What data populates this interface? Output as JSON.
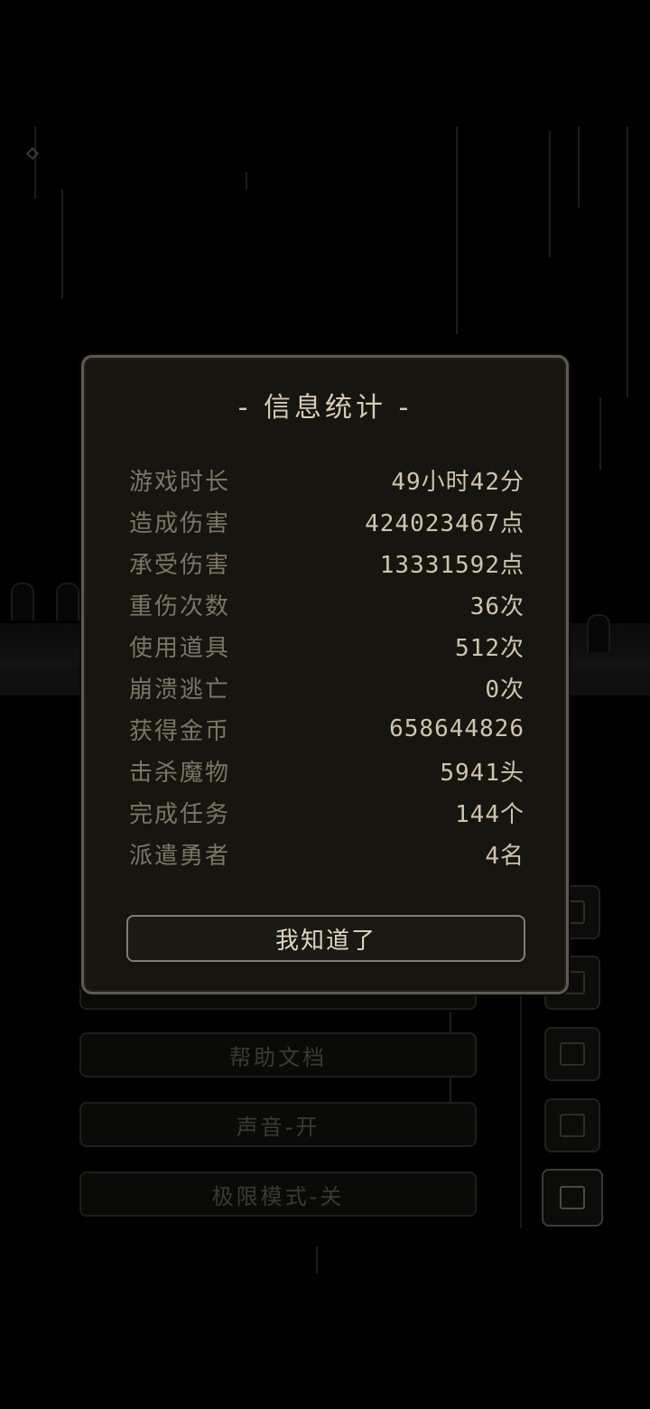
{
  "dialog": {
    "title": "- 信息统计 -",
    "stats": [
      {
        "label": "游戏时长",
        "value": "49小时42分"
      },
      {
        "label": "造成伤害",
        "value": "424023467点"
      },
      {
        "label": "承受伤害",
        "value": "13331592点"
      },
      {
        "label": "重伤次数",
        "value": "36次"
      },
      {
        "label": "使用道具",
        "value": "512次"
      },
      {
        "label": "崩溃逃亡",
        "value": "0次"
      },
      {
        "label": "获得金币",
        "value": "658644826"
      },
      {
        "label": "击杀魔物",
        "value": "5941头"
      },
      {
        "label": "完成任务",
        "value": "144个"
      },
      {
        "label": "派遣勇者",
        "value": "4名"
      }
    ],
    "confirm_label": "我知道了"
  },
  "background_menu": {
    "items": [
      {
        "label": "帮助文档"
      },
      {
        "label": "声音-开"
      },
      {
        "label": "极限模式-关"
      }
    ],
    "side_icons": [
      "sword-icon",
      "edit-icon",
      "card-icon",
      "document-icon",
      "computer-icon"
    ]
  },
  "colors": {
    "modal_bg": "#16150f",
    "modal_border": "#5e5a52",
    "label_text": "#7c7566",
    "value_text": "#cfc4ad",
    "title_text": "#d7ccb5"
  }
}
